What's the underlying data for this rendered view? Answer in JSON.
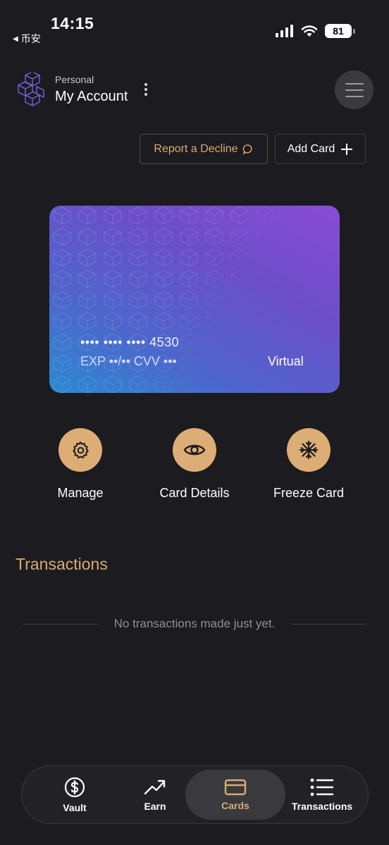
{
  "status_bar": {
    "time": "14:15",
    "back_app": "币安",
    "battery": "81"
  },
  "header": {
    "account_type": "Personal",
    "account_name": "My Account"
  },
  "actions_top": {
    "report_label": "Report a Decline",
    "add_card_label": "Add Card"
  },
  "card": {
    "number_masked": "•••• •••• •••• 4530",
    "exp_cvv": "EXP ••/••  CVV •••",
    "type": "Virtual"
  },
  "card_actions": [
    {
      "label": "Manage",
      "icon": "gear-icon"
    },
    {
      "label": "Card Details",
      "icon": "eye-icon"
    },
    {
      "label": "Freeze Card",
      "icon": "snowflake-icon"
    }
  ],
  "transactions": {
    "title": "Transactions",
    "empty_text": "No transactions made just yet."
  },
  "bottom_nav": {
    "items": [
      {
        "label": "Vault",
        "icon": "dollar-circle-icon"
      },
      {
        "label": "Earn",
        "icon": "trending-up-icon"
      },
      {
        "label": "Cards",
        "icon": "card-icon",
        "active": true
      },
      {
        "label": "Transactions",
        "icon": "list-icon"
      }
    ]
  },
  "colors": {
    "background": "#1c1b20",
    "accent_gold": "#d9ab72",
    "action_circle": "#dcad75",
    "card_gradient_start": "#2a8ad2",
    "card_gradient_end": "#8a4cd4"
  }
}
